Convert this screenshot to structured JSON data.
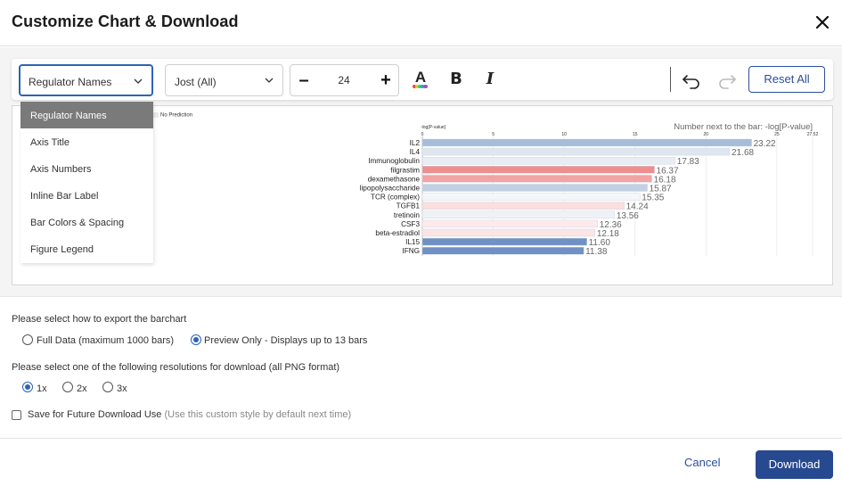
{
  "dialog": {
    "title": "Customize Chart & Download"
  },
  "toolbar": {
    "target_select": "Regulator Names",
    "font_select": "Jost (All)",
    "font_size": "24",
    "font_color_letter": "A",
    "bold_label": "B",
    "italic_label": "I",
    "reset_label": "Reset All"
  },
  "dropdown": {
    "items": [
      {
        "label": "Regulator Names",
        "selected": true
      },
      {
        "label": "Axis Title",
        "selected": false
      },
      {
        "label": "Axis Numbers",
        "selected": false
      },
      {
        "label": "Inline Bar Label",
        "selected": false
      },
      {
        "label": "Bar Colors & Spacing",
        "selected": false
      },
      {
        "label": "Figure Legend",
        "selected": false
      }
    ]
  },
  "preview": {
    "legend_text": "No Prediction"
  },
  "chart_data": {
    "type": "bar",
    "orientation": "horizontal",
    "axis_title": "-log[P-value]",
    "annotation": "Number next to the bar: -log[P-value]",
    "ticks": [
      "0",
      "5",
      "10",
      "15",
      "20",
      "25",
      "27.52"
    ],
    "xlim": [
      0,
      27.52
    ],
    "categories": [
      "IL2",
      "IL4",
      "Immunoglobulin",
      "filgrastim",
      "dexamethasone",
      "lipopolysaccharide",
      "TCR (complex)",
      "TGFB1",
      "tretinoin",
      "CSF3",
      "beta-estradiol",
      "IL15",
      "IFNG"
    ],
    "values": [
      23.22,
      21.68,
      17.83,
      16.37,
      16.18,
      15.87,
      15.35,
      14.24,
      13.56,
      12.36,
      12.18,
      11.6,
      11.38
    ],
    "value_labels": [
      "23.22",
      "21.68",
      "17.83",
      "16.37",
      "16.18",
      "15.87",
      "15.35",
      "14.24",
      "13.56",
      "12.36",
      "12.18",
      "11.60",
      "11.38"
    ],
    "bar_colors": [
      "#a6bcd9",
      "#dfe6f0",
      "#e8edf4",
      "#ee8e8e",
      "#f2a3a3",
      "#c3d0e3",
      "#f4f6f9",
      "#fbdede",
      "#eef2f7",
      "#fdeaea",
      "#fbe5e5",
      "#6f91c4",
      "#6f91c4"
    ],
    "grid": true,
    "legend": "top-left"
  },
  "export": {
    "question1": "Please select how to export the barchart",
    "options1": [
      {
        "label": "Full Data (maximum 1000 bars)",
        "checked": false
      },
      {
        "label": "Preview Only - Displays up to 13 bars",
        "checked": true
      }
    ],
    "question2": "Please select one of the following resolutions for download (all PNG format)",
    "options2": [
      {
        "label": "1x",
        "checked": true
      },
      {
        "label": "2x",
        "checked": false
      },
      {
        "label": "3x",
        "checked": false
      }
    ],
    "save_label": "Save for Future Download Use",
    "save_hint": "(Use this custom style by default next time)"
  },
  "footer": {
    "cancel_label": "Cancel",
    "download_label": "Download"
  },
  "colors": {
    "accent": "#2d63b8",
    "primary_button": "#27498f"
  }
}
